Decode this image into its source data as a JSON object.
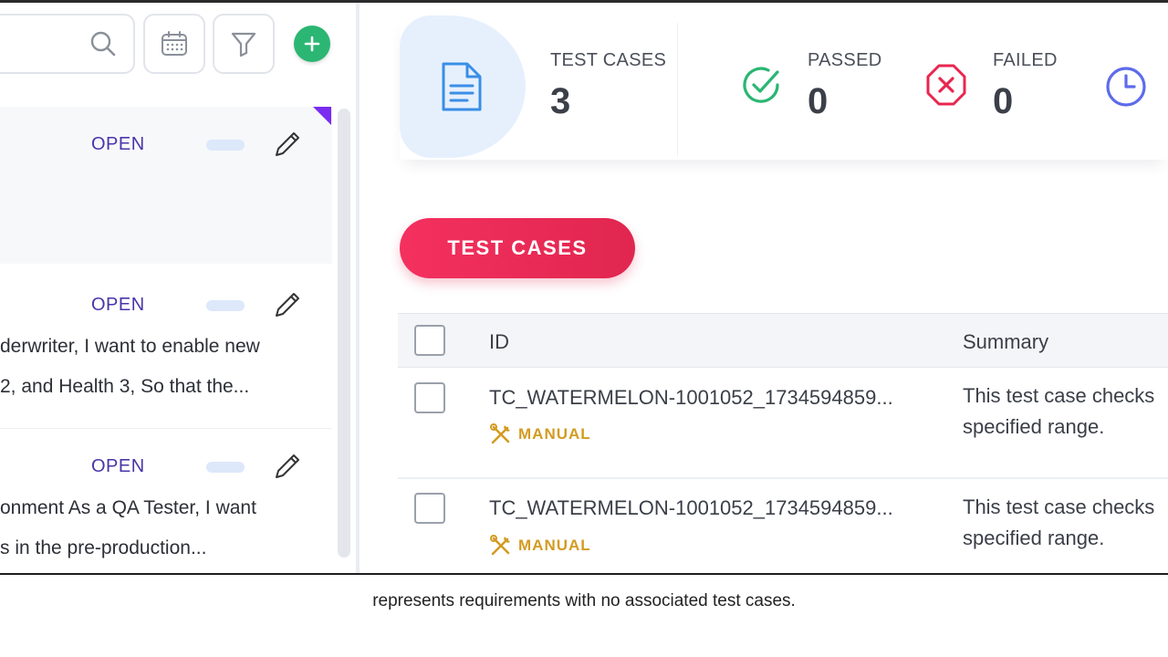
{
  "left_pane": {
    "search": {
      "placeholder": ""
    },
    "requirements": [
      {
        "status": "OPEN",
        "line1": "",
        "line2": ""
      },
      {
        "status": "OPEN",
        "line1": "derwriter, I want to enable new",
        "line2": "2, and Health 3, So that the..."
      },
      {
        "status": "OPEN",
        "line1": "onment As a QA Tester, I want",
        "line2": "s in the pre-production..."
      }
    ]
  },
  "stats": {
    "test_cases": {
      "label": "TEST CASES",
      "value": "3"
    },
    "passed": {
      "label": "PASSED",
      "value": "0"
    },
    "failed": {
      "label": "FAILED",
      "value": "0"
    }
  },
  "test_cases_button": "TEST CASES",
  "table": {
    "headers": {
      "id": "ID",
      "summary": "Summary"
    },
    "rows": [
      {
        "id": "TC_WATERMELON-1001052_1734594859...",
        "type": "MANUAL",
        "summary_line1": "This test case checks",
        "summary_line2": "specified range."
      },
      {
        "id": "TC_WATERMELON-1001052_1734594859...",
        "type": "MANUAL",
        "summary_line1": "This test case checks",
        "summary_line2": "specified range."
      }
    ]
  },
  "caption": "represents requirements with no associated test cases.",
  "colors": {
    "accent_green": "#2bb673",
    "passed_green": "#2bb673",
    "failed_red": "#e8264f",
    "status_purple": "#4a35a8",
    "button_pink": "#f4305f",
    "manual_gold": "#d39b22"
  }
}
